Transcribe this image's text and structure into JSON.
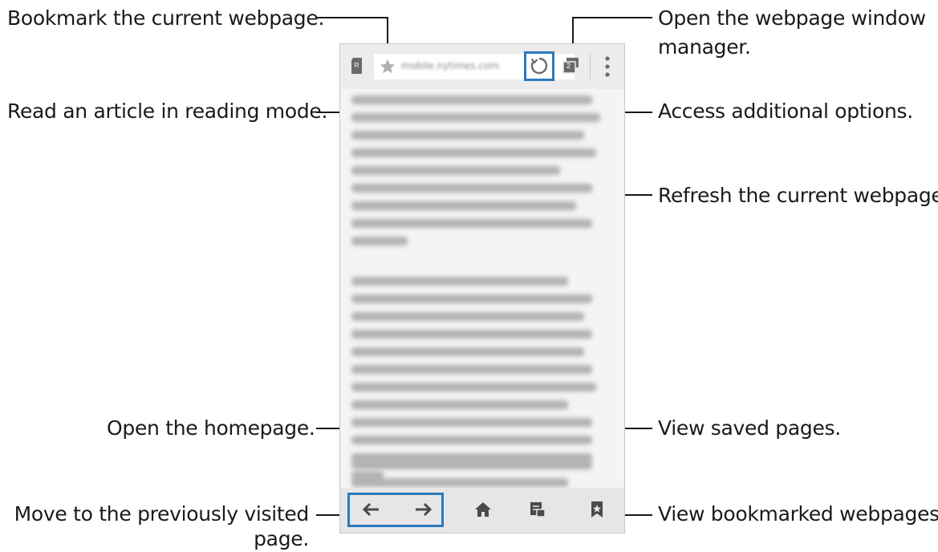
{
  "callouts": {
    "bookmark_current": "Bookmark the current webpage.",
    "reading_mode": "Read an article in reading mode.",
    "window_manager_line1": "Open the webpage window",
    "window_manager_line2": "manager.",
    "additional_options": "Access additional options.",
    "refresh": "Refresh the current webpage.",
    "homepage": "Open the homepage.",
    "saved_pages": "View saved pages.",
    "prev_page_line1": "Move to the previously visited",
    "prev_page_line2": "page.",
    "bookmarks": "View bookmarked webpages."
  },
  "browser": {
    "url": "mobile.nytimes.com",
    "tab_count": "2"
  },
  "colors": {
    "highlight": "#2a7bbf",
    "icon_gray": "#6a6a6a"
  }
}
